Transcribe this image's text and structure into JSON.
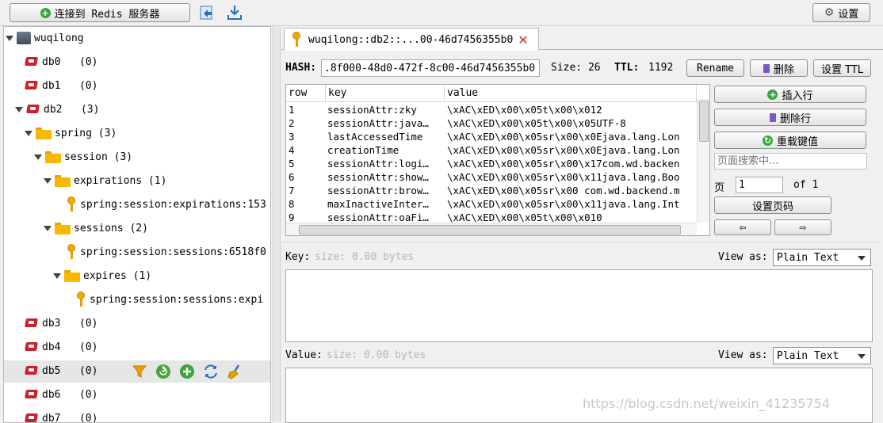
{
  "toolbar": {
    "connect_label": "连接到 Redis 服务器",
    "settings_label": "设置",
    "icons": [
      "connect-plus-icon",
      "import-icon",
      "export-icon",
      "gear-icon"
    ]
  },
  "tree": {
    "server": "wuqilong",
    "nodes": [
      {
        "label": "db0",
        "count": "(0)"
      },
      {
        "label": "db1",
        "count": "(0)"
      },
      {
        "label": "db2",
        "count": "(3)"
      },
      {
        "label": "spring",
        "count": "(3)"
      },
      {
        "label": "session",
        "count": "(3)"
      },
      {
        "label": "expirations",
        "count": "(1)"
      },
      {
        "label": "spring:session:expirations:153"
      },
      {
        "label": "sessions",
        "count": "(2)"
      },
      {
        "label": "spring:session:sessions:6518f0"
      },
      {
        "label": "expires",
        "count": "(1)"
      },
      {
        "label": "spring:session:sessions:expi"
      },
      {
        "label": "db3",
        "count": "(0)"
      },
      {
        "label": "db4",
        "count": "(0)"
      },
      {
        "label": "db5",
        "count": "(0)"
      },
      {
        "label": "db6",
        "count": "(0)"
      },
      {
        "label": "db7",
        "count": "(0)"
      }
    ]
  },
  "tab": {
    "title": "wuqilong::db2::...00-46d7456355b0",
    "close_icon": "close-icon"
  },
  "key_header": {
    "type_label": "HASH:",
    "key_value": ".8f000-48d0-472f-8c00-46d7456355b0",
    "size_label": "Size: 26",
    "ttl_label": "TTL:",
    "ttl_value": "1192",
    "rename_label": "Rename",
    "delete_label": "删除",
    "set_ttl_label": "设置 TTL"
  },
  "table": {
    "columns": [
      "row",
      "key",
      "value"
    ],
    "rows": [
      [
        "1",
        "sessionAttr:zky",
        "\\xAC\\xED\\x00\\x05t\\x00\\x012"
      ],
      [
        "2",
        "sessionAttr:java…",
        "\\xAC\\xED\\x00\\x05t\\x00\\x05UTF-8"
      ],
      [
        "3",
        "lastAccessedTime",
        "\\xAC\\xED\\x00\\x05sr\\x00\\x0Ejava.lang.Lon"
      ],
      [
        "4",
        "creationTime",
        "\\xAC\\xED\\x00\\x05sr\\x00\\x0Ejava.lang.Lon"
      ],
      [
        "5",
        "sessionAttr:logi…",
        "\\xAC\\xED\\x00\\x05sr\\x00\\x17com.wd.backen"
      ],
      [
        "6",
        "sessionAttr:show…",
        "\\xAC\\xED\\x00\\x05sr\\x00\\x11java.lang.Boo"
      ],
      [
        "7",
        "sessionAttr:brow…",
        "\\xAC\\xED\\x00\\x05sr\\x00 com.wd.backend.m"
      ],
      [
        "8",
        "maxInactiveInter…",
        "\\xAC\\xED\\x00\\x05sr\\x00\\x11java.lang.Int"
      ],
      [
        "9",
        "sessionAttr:oaFi…",
        "\\xAC\\xED\\x00\\x05t\\x00\\x010"
      ]
    ]
  },
  "side_actions": {
    "insert_row": "插入行",
    "delete_row": "删除行",
    "reload": "重载键值",
    "search_placeholder": "页面搜索中...",
    "page_label": "页",
    "page_value": "1",
    "of_label": "of 1",
    "set_page": "设置页码",
    "prev": "⇦",
    "next": "⇨"
  },
  "key_editor": {
    "label": "Key:",
    "size_hint": "size: 0.00 bytes",
    "view_as_label": "View as:",
    "view_as_value": "Plain Text"
  },
  "value_editor": {
    "label": "Value:",
    "size_hint": "size: 0.00 bytes",
    "view_as_label": "View as:",
    "view_as_value": "Plain Text"
  },
  "watermark": "https://blog.csdn.net/weixin_41235754"
}
